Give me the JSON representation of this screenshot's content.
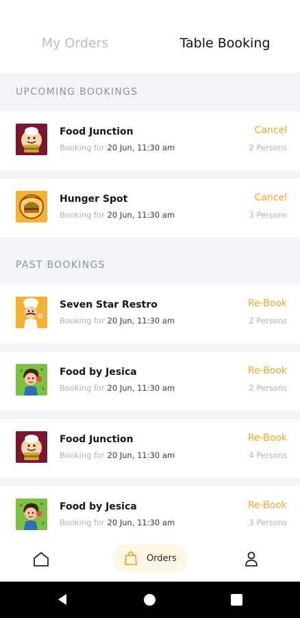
{
  "tabs": [
    {
      "label": "My Orders",
      "active": false
    },
    {
      "label": "Table Booking",
      "active": true
    }
  ],
  "upcoming": {
    "title": "UPCOMING BOOKINGS",
    "items": [
      {
        "name": "Food Junction",
        "booking_prefix": "Booking for",
        "date": "20 Jun, 11:30 am",
        "action": "Cancel",
        "persons": "2 Persons",
        "logo": "chef-burger-logo"
      },
      {
        "name": "Hunger Spot",
        "booking_prefix": "Booking for",
        "date": "20 Jun, 11:30 am",
        "action": "Cancel",
        "persons": "3 Persons",
        "logo": "burger-badge-logo"
      }
    ]
  },
  "past": {
    "title": "PAST BOOKINGS",
    "items": [
      {
        "name": "Seven Star Restro",
        "booking_prefix": "Booking for",
        "date": "20 Jun, 11:30 am",
        "action": "Re-Book",
        "persons": "2 Persons",
        "logo": "chef-cartoon-logo"
      },
      {
        "name": "Food by Jesica",
        "booking_prefix": "Booking for",
        "date": "20 Jun, 11:30 am",
        "action": "Re-Book",
        "persons": "2 Persons",
        "logo": "girl-cartoon-logo"
      },
      {
        "name": "Food Junction",
        "booking_prefix": "Booking for",
        "date": "20 Jun, 11:30 am",
        "action": "Re-Book",
        "persons": "4 Persons",
        "logo": "chef-burger-logo"
      },
      {
        "name": "Food by Jesica",
        "booking_prefix": "Booking for",
        "date": "20 Jun, 11:30 am",
        "action": "Re-Book",
        "persons": "3 Persons",
        "logo": "girl-cartoon-logo"
      }
    ]
  },
  "bottom_nav": {
    "home_icon": "home-icon",
    "orders_label": "Orders",
    "orders_icon": "shopping-bag-icon",
    "profile_icon": "user-icon"
  },
  "system_nav": {
    "back_icon": "back-triangle-icon",
    "home_icon": "home-circle-icon",
    "recent_icon": "recent-square-icon"
  },
  "colors": {
    "accent": "#f5a623",
    "section_bg": "#f3f4f8",
    "muted_text": "#b2b2b2",
    "inactive_tab": "#bdbdbd"
  }
}
